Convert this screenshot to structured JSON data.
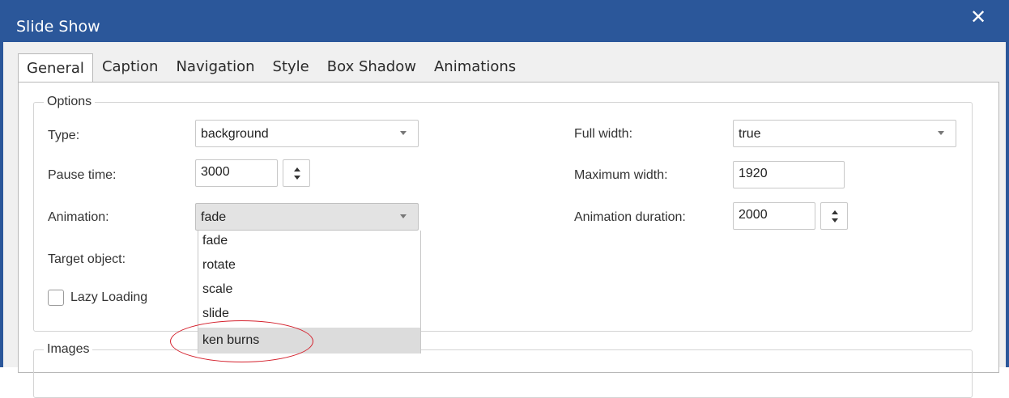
{
  "window": {
    "title": "Slide Show",
    "close_glyph": "✕"
  },
  "tabs": [
    {
      "label": "General",
      "active": true
    },
    {
      "label": "Caption"
    },
    {
      "label": "Navigation"
    },
    {
      "label": "Style"
    },
    {
      "label": "Box Shadow"
    },
    {
      "label": "Animations"
    }
  ],
  "options_group": {
    "legend": "Options",
    "type": {
      "label": "Type:",
      "value": "background"
    },
    "pause_time": {
      "label": "Pause time:",
      "value": "3000"
    },
    "animation": {
      "label": "Animation:",
      "value": "fade",
      "options": [
        "fade",
        "rotate",
        "scale",
        "slide",
        "ken burns"
      ],
      "highlighted": "ken burns"
    },
    "target_object": {
      "label": "Target object:"
    },
    "lazy_loading": {
      "label": "Lazy Loading",
      "checked": false
    },
    "full_width": {
      "label": "Full width:",
      "value": "true"
    },
    "maximum_width": {
      "label": "Maximum width:",
      "value": "1920"
    },
    "animation_duration": {
      "label": "Animation duration:",
      "value": "2000"
    }
  },
  "images_group": {
    "legend": "Images"
  },
  "colors": {
    "titlebar": "#2b579a",
    "annotation": "#d4202c",
    "highlight": "#dcdcdc"
  },
  "icons": {
    "close": "close-icon",
    "dropdown": "chevron-down-icon",
    "spin_up": "spin-up-icon",
    "spin_down": "spin-down-icon"
  }
}
